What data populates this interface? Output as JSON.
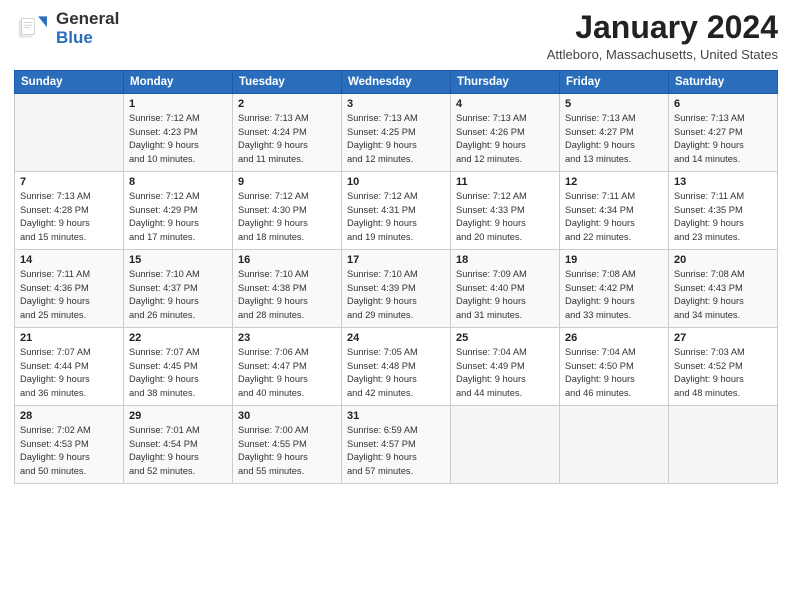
{
  "header": {
    "logo": {
      "line1": "General",
      "line2": "Blue"
    },
    "title": "January 2024",
    "location": "Attleboro, Massachusetts, United States"
  },
  "weekdays": [
    "Sunday",
    "Monday",
    "Tuesday",
    "Wednesday",
    "Thursday",
    "Friday",
    "Saturday"
  ],
  "weeks": [
    [
      {
        "day": "",
        "sunrise": "",
        "sunset": "",
        "daylight": ""
      },
      {
        "day": "1",
        "sunrise": "Sunrise: 7:12 AM",
        "sunset": "Sunset: 4:23 PM",
        "daylight": "Daylight: 9 hours and 10 minutes."
      },
      {
        "day": "2",
        "sunrise": "Sunrise: 7:13 AM",
        "sunset": "Sunset: 4:24 PM",
        "daylight": "Daylight: 9 hours and 11 minutes."
      },
      {
        "day": "3",
        "sunrise": "Sunrise: 7:13 AM",
        "sunset": "Sunset: 4:25 PM",
        "daylight": "Daylight: 9 hours and 12 minutes."
      },
      {
        "day": "4",
        "sunrise": "Sunrise: 7:13 AM",
        "sunset": "Sunset: 4:26 PM",
        "daylight": "Daylight: 9 hours and 12 minutes."
      },
      {
        "day": "5",
        "sunrise": "Sunrise: 7:13 AM",
        "sunset": "Sunset: 4:27 PM",
        "daylight": "Daylight: 9 hours and 13 minutes."
      },
      {
        "day": "6",
        "sunrise": "Sunrise: 7:13 AM",
        "sunset": "Sunset: 4:27 PM",
        "daylight": "Daylight: 9 hours and 14 minutes."
      }
    ],
    [
      {
        "day": "7",
        "sunrise": "Sunrise: 7:13 AM",
        "sunset": "Sunset: 4:28 PM",
        "daylight": "Daylight: 9 hours and 15 minutes."
      },
      {
        "day": "8",
        "sunrise": "Sunrise: 7:12 AM",
        "sunset": "Sunset: 4:29 PM",
        "daylight": "Daylight: 9 hours and 17 minutes."
      },
      {
        "day": "9",
        "sunrise": "Sunrise: 7:12 AM",
        "sunset": "Sunset: 4:30 PM",
        "daylight": "Daylight: 9 hours and 18 minutes."
      },
      {
        "day": "10",
        "sunrise": "Sunrise: 7:12 AM",
        "sunset": "Sunset: 4:31 PM",
        "daylight": "Daylight: 9 hours and 19 minutes."
      },
      {
        "day": "11",
        "sunrise": "Sunrise: 7:12 AM",
        "sunset": "Sunset: 4:33 PM",
        "daylight": "Daylight: 9 hours and 20 minutes."
      },
      {
        "day": "12",
        "sunrise": "Sunrise: 7:11 AM",
        "sunset": "Sunset: 4:34 PM",
        "daylight": "Daylight: 9 hours and 22 minutes."
      },
      {
        "day": "13",
        "sunrise": "Sunrise: 7:11 AM",
        "sunset": "Sunset: 4:35 PM",
        "daylight": "Daylight: 9 hours and 23 minutes."
      }
    ],
    [
      {
        "day": "14",
        "sunrise": "Sunrise: 7:11 AM",
        "sunset": "Sunset: 4:36 PM",
        "daylight": "Daylight: 9 hours and 25 minutes."
      },
      {
        "day": "15",
        "sunrise": "Sunrise: 7:10 AM",
        "sunset": "Sunset: 4:37 PM",
        "daylight": "Daylight: 9 hours and 26 minutes."
      },
      {
        "day": "16",
        "sunrise": "Sunrise: 7:10 AM",
        "sunset": "Sunset: 4:38 PM",
        "daylight": "Daylight: 9 hours and 28 minutes."
      },
      {
        "day": "17",
        "sunrise": "Sunrise: 7:10 AM",
        "sunset": "Sunset: 4:39 PM",
        "daylight": "Daylight: 9 hours and 29 minutes."
      },
      {
        "day": "18",
        "sunrise": "Sunrise: 7:09 AM",
        "sunset": "Sunset: 4:40 PM",
        "daylight": "Daylight: 9 hours and 31 minutes."
      },
      {
        "day": "19",
        "sunrise": "Sunrise: 7:08 AM",
        "sunset": "Sunset: 4:42 PM",
        "daylight": "Daylight: 9 hours and 33 minutes."
      },
      {
        "day": "20",
        "sunrise": "Sunrise: 7:08 AM",
        "sunset": "Sunset: 4:43 PM",
        "daylight": "Daylight: 9 hours and 34 minutes."
      }
    ],
    [
      {
        "day": "21",
        "sunrise": "Sunrise: 7:07 AM",
        "sunset": "Sunset: 4:44 PM",
        "daylight": "Daylight: 9 hours and 36 minutes."
      },
      {
        "day": "22",
        "sunrise": "Sunrise: 7:07 AM",
        "sunset": "Sunset: 4:45 PM",
        "daylight": "Daylight: 9 hours and 38 minutes."
      },
      {
        "day": "23",
        "sunrise": "Sunrise: 7:06 AM",
        "sunset": "Sunset: 4:47 PM",
        "daylight": "Daylight: 9 hours and 40 minutes."
      },
      {
        "day": "24",
        "sunrise": "Sunrise: 7:05 AM",
        "sunset": "Sunset: 4:48 PM",
        "daylight": "Daylight: 9 hours and 42 minutes."
      },
      {
        "day": "25",
        "sunrise": "Sunrise: 7:04 AM",
        "sunset": "Sunset: 4:49 PM",
        "daylight": "Daylight: 9 hours and 44 minutes."
      },
      {
        "day": "26",
        "sunrise": "Sunrise: 7:04 AM",
        "sunset": "Sunset: 4:50 PM",
        "daylight": "Daylight: 9 hours and 46 minutes."
      },
      {
        "day": "27",
        "sunrise": "Sunrise: 7:03 AM",
        "sunset": "Sunset: 4:52 PM",
        "daylight": "Daylight: 9 hours and 48 minutes."
      }
    ],
    [
      {
        "day": "28",
        "sunrise": "Sunrise: 7:02 AM",
        "sunset": "Sunset: 4:53 PM",
        "daylight": "Daylight: 9 hours and 50 minutes."
      },
      {
        "day": "29",
        "sunrise": "Sunrise: 7:01 AM",
        "sunset": "Sunset: 4:54 PM",
        "daylight": "Daylight: 9 hours and 52 minutes."
      },
      {
        "day": "30",
        "sunrise": "Sunrise: 7:00 AM",
        "sunset": "Sunset: 4:55 PM",
        "daylight": "Daylight: 9 hours and 55 minutes."
      },
      {
        "day": "31",
        "sunrise": "Sunrise: 6:59 AM",
        "sunset": "Sunset: 4:57 PM",
        "daylight": "Daylight: 9 hours and 57 minutes."
      },
      {
        "day": "",
        "sunrise": "",
        "sunset": "",
        "daylight": ""
      },
      {
        "day": "",
        "sunrise": "",
        "sunset": "",
        "daylight": ""
      },
      {
        "day": "",
        "sunrise": "",
        "sunset": "",
        "daylight": ""
      }
    ]
  ]
}
